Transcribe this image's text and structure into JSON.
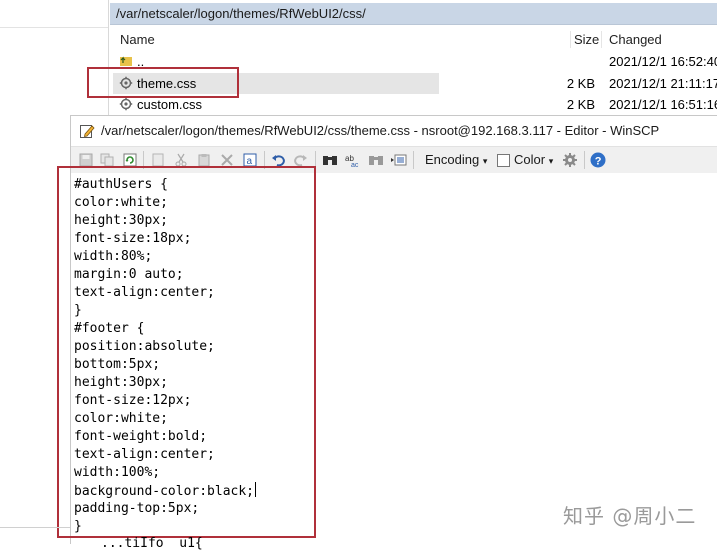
{
  "file_panel": {
    "path": "/var/netscaler/logon/themes/RfWebUI2/css/",
    "columns": {
      "name": "Name",
      "size": "Size",
      "changed": "Changed"
    },
    "rows": [
      {
        "name": "..",
        "size": "",
        "changed": "2021/12/1 16:52:40"
      },
      {
        "name": "theme.css",
        "size": "2 KB",
        "changed": "2021/12/1 21:11:17"
      },
      {
        "name": "custom.css",
        "size": "2 KB",
        "changed": "2021/12/1 16:51:16"
      }
    ]
  },
  "editor": {
    "title": "/var/netscaler/logon/themes/RfWebUI2/css/theme.css - nsroot@192.168.3.117 - Editor - WinSCP",
    "toolbar": {
      "encoding_label": "Encoding",
      "color_label": "Color",
      "icons": [
        "save-icon",
        "copy-icon",
        "reload-icon",
        "copy-doc-icon",
        "cut-icon",
        "paste-icon",
        "delete-icon",
        "select-all-icon",
        "undo-icon",
        "redo-icon",
        "find-icon",
        "replace-icon",
        "find-next-icon",
        "goto-line-icon",
        "gear-icon",
        "help-icon"
      ]
    },
    "code_lines": [
      "#authUsers {",
      "color:white;",
      "height:30px;",
      "font-size:18px;",
      "width:80%;",
      "margin:0 auto;",
      "text-align:center;",
      "}",
      "#footer {",
      "position:absolute;",
      "bottom:5px;",
      "height:30px;",
      "font-size:12px;",
      "color:white;",
      "font-weight:bold;",
      "text-align:center;",
      "width:100%;",
      "background-color:black;",
      "padding-top:5px;",
      "}"
    ],
    "partial_next_line": "...tiIfo  u1{"
  },
  "watermark": "知乎 @周小二",
  "colors": {
    "highlight_red": "#b0303a",
    "path_bar": "#c9d6e6",
    "selection": "#e5e5e5"
  }
}
